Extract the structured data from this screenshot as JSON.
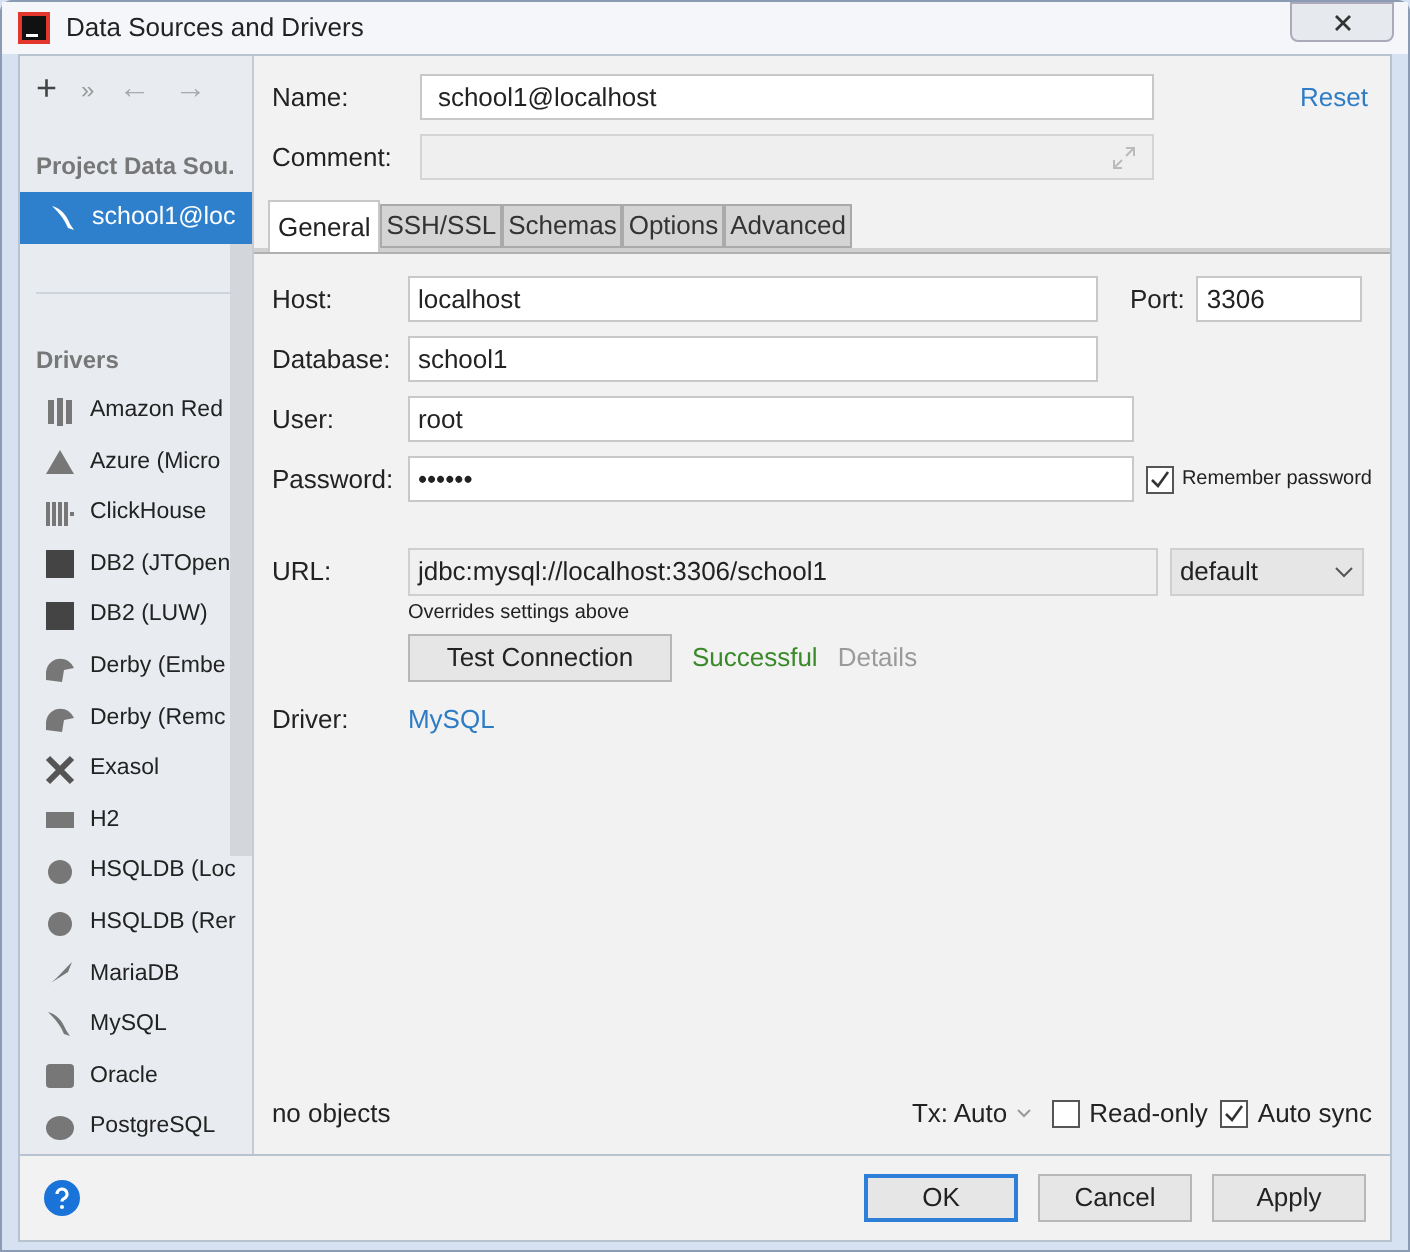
{
  "window": {
    "title": "Data Sources and Drivers"
  },
  "sidebar": {
    "toolbar": [
      "+",
      "»",
      "←",
      "→"
    ],
    "section_title": "Project Data Sou.",
    "data_sources": [
      {
        "label": "school1@loc",
        "selected": true
      }
    ],
    "drivers_title": "Drivers",
    "drivers": [
      {
        "label": "Amazon Red"
      },
      {
        "label": "Azure (Micro"
      },
      {
        "label": "ClickHouse"
      },
      {
        "label": "DB2 (JTOpen"
      },
      {
        "label": "DB2 (LUW)"
      },
      {
        "label": "Derby (Embe"
      },
      {
        "label": "Derby (Remc"
      },
      {
        "label": "Exasol"
      },
      {
        "label": "H2"
      },
      {
        "label": "HSQLDB (Loc"
      },
      {
        "label": "HSQLDB (Rer"
      },
      {
        "label": "MariaDB"
      },
      {
        "label": "MySQL"
      },
      {
        "label": "Oracle"
      },
      {
        "label": "PostgreSQL"
      }
    ]
  },
  "name": {
    "label": "Name:",
    "value": "school1@localhost"
  },
  "reset": "Reset",
  "comment": {
    "label": "Comment:"
  },
  "tabs": [
    {
      "label": "General",
      "selected": true
    },
    {
      "label": "SSH/SSL",
      "selected": false
    },
    {
      "label": "Schemas",
      "selected": false
    },
    {
      "label": "Options",
      "selected": false
    },
    {
      "label": "Advanced",
      "selected": false
    }
  ],
  "host": {
    "label": "Host:",
    "value": "localhost"
  },
  "port": {
    "label": "Port:",
    "value": "3306"
  },
  "database": {
    "label": "Database:",
    "value": "school1"
  },
  "user": {
    "label": "User:",
    "value": "root"
  },
  "password": {
    "label": "Password:",
    "value": "••••••"
  },
  "remember_password": {
    "label": "Remember password",
    "checked": true
  },
  "url": {
    "label": "URL:",
    "value": "jdbc:mysql://localhost:3306/school1",
    "mode": "default",
    "hint": "Overrides settings above"
  },
  "test_connection": {
    "label": "Test Connection",
    "status": "Successful",
    "details": "Details"
  },
  "driver": {
    "label": "Driver:",
    "value": "MySQL"
  },
  "objects": "no objects",
  "tx": "Tx: Auto",
  "read_only": {
    "label": "Read-only",
    "checked": false
  },
  "auto_sync": {
    "label": "Auto sync",
    "checked": true
  },
  "buttons": [
    {
      "label": "OK",
      "default": true
    },
    {
      "label": "Cancel",
      "default": false
    },
    {
      "label": "Apply",
      "default": false
    }
  ]
}
